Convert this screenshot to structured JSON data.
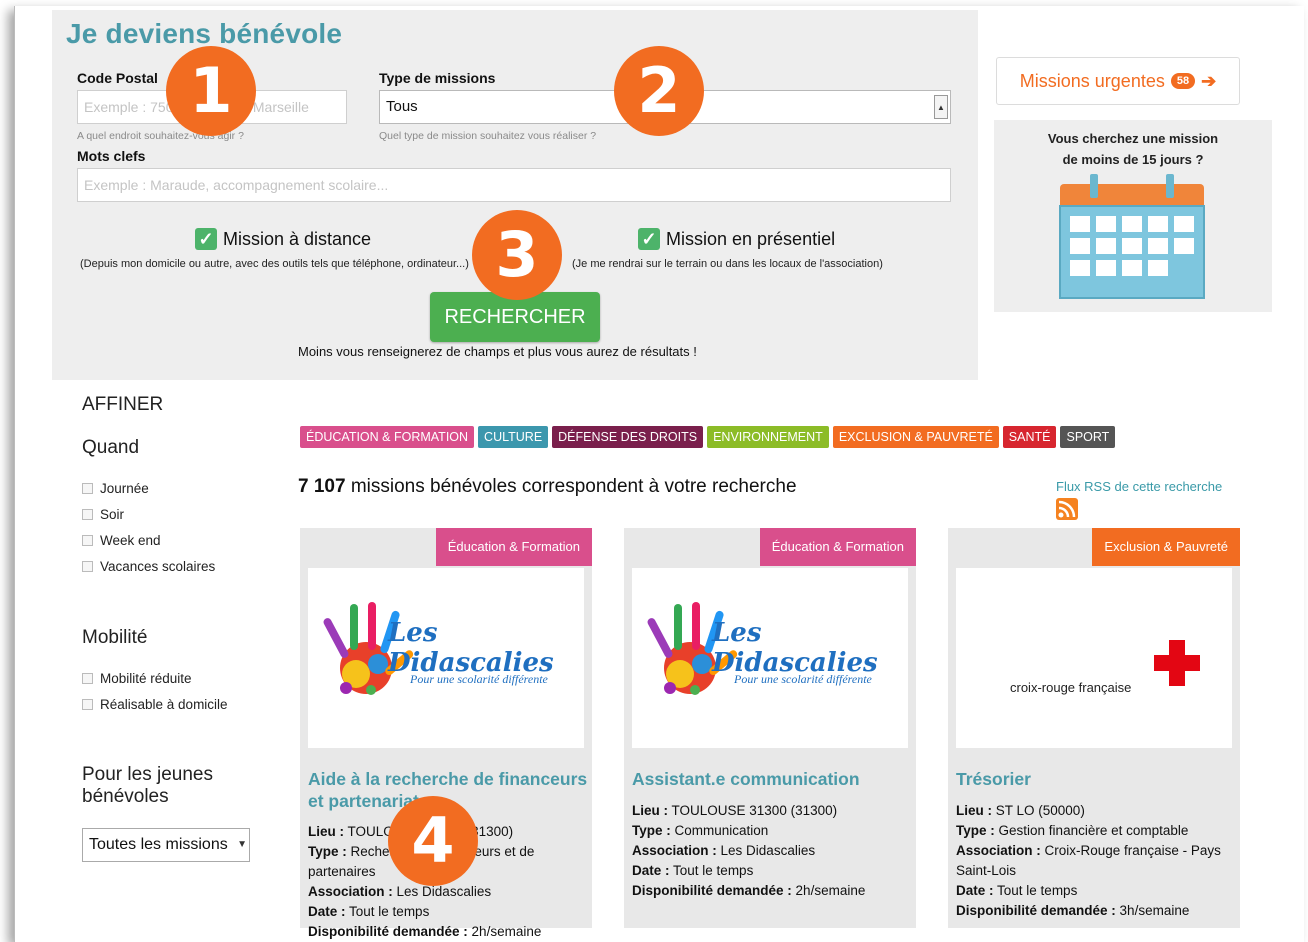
{
  "title": "Je deviens bénévole",
  "form": {
    "postal_label": "Code Postal",
    "postal_placeholder": "Exemple : 75012, Rennes, Marseille",
    "postal_hint": "A quel endroit souhaitez-vous agir ?",
    "type_label": "Type de missions",
    "type_value": "Tous",
    "type_hint": "Quel type de mission souhaitez vous réaliser ?",
    "keywords_label": "Mots clefs",
    "keywords_placeholder": "Exemple : Maraude, accompagnement scolaire...",
    "remote_label": "Mission à distance",
    "remote_hint": "(Depuis mon domicile ou autre, avec des outils tels que téléphone, ordinateur...)",
    "onsite_label": "Mission en présentiel",
    "onsite_hint": "(Je me rendrai sur le terrain ou dans les locaux de l'association)",
    "search_button": "RECHERCHER",
    "below_hint": "Moins vous renseignerez de champs et plus vous aurez de résultats !"
  },
  "badges": [
    "1",
    "2",
    "3",
    "4"
  ],
  "urgent": {
    "label": "Missions urgentes",
    "count": "58",
    "arrow": "➔",
    "text_line1": "Vous cherchez une mission",
    "text_line2": "de moins de 15 jours ?"
  },
  "sidebar": {
    "title": "AFFINER",
    "when_title": "Quand",
    "when_items": [
      "Journée",
      "Soir",
      "Week end",
      "Vacances scolaires"
    ],
    "mobility_title": "Mobilité",
    "mobility_items": [
      "Mobilité réduite",
      "Réalisable à domicile"
    ],
    "young_title_1": "Pour les jeunes",
    "young_title_2": "bénévoles",
    "young_select": "Toutes les missions"
  },
  "categories": [
    {
      "label": "ÉDUCATION & FORMATION",
      "color": "#d94f8c"
    },
    {
      "label": "CULTURE",
      "color": "#3c97ad"
    },
    {
      "label": "DÉFENSE DES DROITS",
      "color": "#7a1f4c"
    },
    {
      "label": "ENVIRONNEMENT",
      "color": "#8cbc27"
    },
    {
      "label": "EXCLUSION & PAUVRETÉ",
      "color": "#f26c21"
    },
    {
      "label": "SANTÉ",
      "color": "#d7262f"
    },
    {
      "label": "SPORT",
      "color": "#555555"
    }
  ],
  "results": {
    "count": "7 107",
    "text": "missions bénévoles correspondent à votre recherche",
    "rss": "Flux RSS de cette recherche"
  },
  "cards": [
    {
      "tag": "Éducation & Formation",
      "tag_color": "#d94f8c",
      "org_logo": "Les Didascalies",
      "org_tagline": "Pour une scolarité différente",
      "title": "Aide à la recherche de financeurs et partenariats",
      "lieu_label": "Lieu :",
      "lieu": "TOULOUSE 31300 (31300)",
      "type_label": "Type :",
      "type": "Recherche de financeurs et de partenaires",
      "assoc_label": "Association :",
      "assoc": "Les Didascalies",
      "date_label": "Date :",
      "date": "Tout le temps",
      "dispo_label": "Disponibilité demandée :",
      "dispo": "2h/semaine"
    },
    {
      "tag": "Éducation & Formation",
      "tag_color": "#d94f8c",
      "org_logo": "Les Didascalies",
      "org_tagline": "Pour une scolarité différente",
      "title": "Assistant.e communication",
      "lieu_label": "Lieu :",
      "lieu": "TOULOUSE 31300 (31300)",
      "type_label": "Type :",
      "type": "Communication",
      "assoc_label": "Association :",
      "assoc": "Les Didascalies",
      "date_label": "Date :",
      "date": "Tout le temps",
      "dispo_label": "Disponibilité demandée :",
      "dispo": "2h/semaine"
    },
    {
      "tag": "Exclusion & Pauvreté",
      "tag_color": "#f26c21",
      "org_logo": "croix-rouge française",
      "title": "Trésorier",
      "lieu_label": "Lieu :",
      "lieu": "ST LO (50000)",
      "type_label": "Type :",
      "type": "Gestion financière et comptable",
      "assoc_label": "Association :",
      "assoc": "Croix-Rouge française - Pays Saint-Lois",
      "date_label": "Date :",
      "date": "Tout le temps",
      "dispo_label": "Disponibilité demandée :",
      "dispo": "3h/semaine"
    }
  ]
}
